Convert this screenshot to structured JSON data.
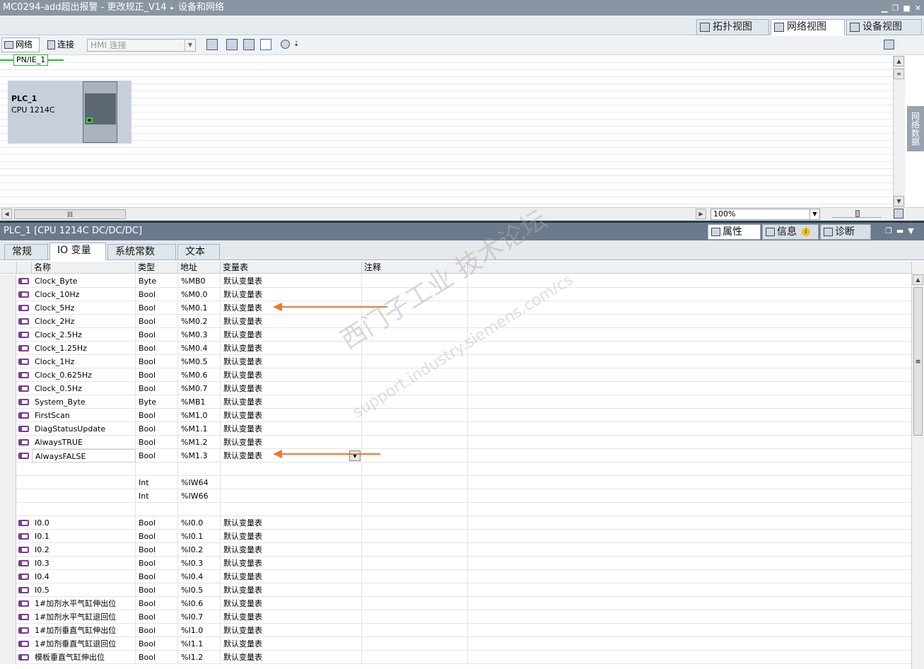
{
  "titlebar": {
    "project": "MC0294-add超出报警 - 更改规正_V14",
    "separator": "▸",
    "location": "设备和网络"
  },
  "view_tabs": [
    {
      "label": "拓扑视图",
      "icon": "topology-icon"
    },
    {
      "label": "网络视图",
      "icon": "network-icon",
      "active": true
    },
    {
      "label": "设备视图",
      "icon": "device-icon"
    }
  ],
  "toolbar": {
    "network_label": "网络",
    "connect_label": "连接",
    "hmi_connection_placeholder": "HMI 连接"
  },
  "canvas": {
    "subnet_label": "PN/IE_1",
    "plc_name": "PLC_1",
    "plc_type": "CPU 1214C",
    "side_panel_label": "网络数据",
    "zoom_value": "100%"
  },
  "inspector": {
    "title": "PLC_1 [CPU 1214C DC/DC/DC]",
    "tabs": [
      "属性",
      "信息",
      "诊断"
    ],
    "property_tabs": [
      "常规",
      "IO 变量",
      "系统常数",
      "文本"
    ],
    "active_property_tab": 1
  },
  "io_table": {
    "headers": [
      "名称",
      "类型",
      "地址",
      "变量表",
      "注释"
    ],
    "rows": [
      {
        "name": "Clock_Byte",
        "type": "Byte",
        "address": "%MB0",
        "table": "默认变量表",
        "icon": true
      },
      {
        "name": "Clock_10Hz",
        "type": "Bool",
        "address": "%M0.0",
        "table": "默认变量表",
        "icon": true
      },
      {
        "name": "Clock_5Hz",
        "type": "Bool",
        "address": "%M0.1",
        "table": "默认变量表",
        "icon": true
      },
      {
        "name": "Clock_2Hz",
        "type": "Bool",
        "address": "%M0.2",
        "table": "默认变量表",
        "icon": true
      },
      {
        "name": "Clock_2.5Hz",
        "type": "Bool",
        "address": "%M0.3",
        "table": "默认变量表",
        "icon": true
      },
      {
        "name": "Clock_1.25Hz",
        "type": "Bool",
        "address": "%M0.4",
        "table": "默认变量表",
        "icon": true
      },
      {
        "name": "Clock_1Hz",
        "type": "Bool",
        "address": "%M0.5",
        "table": "默认变量表",
        "icon": true
      },
      {
        "name": "Clock_0.625Hz",
        "type": "Bool",
        "address": "%M0.6",
        "table": "默认变量表",
        "icon": true
      },
      {
        "name": "Clock_0.5Hz",
        "type": "Bool",
        "address": "%M0.7",
        "table": "默认变量表",
        "icon": true
      },
      {
        "name": "System_Byte",
        "type": "Byte",
        "address": "%MB1",
        "table": "默认变量表",
        "icon": true
      },
      {
        "name": "FirstScan",
        "type": "Bool",
        "address": "%M1.0",
        "table": "默认变量表",
        "icon": true
      },
      {
        "name": "DiagStatusUpdate",
        "type": "Bool",
        "address": "%M1.1",
        "table": "默认变量表",
        "icon": true
      },
      {
        "name": "AlwaysTRUE",
        "type": "Bool",
        "address": "%M1.2",
        "table": "默认变量表",
        "icon": true
      },
      {
        "name": "AlwaysFALSE",
        "type": "Bool",
        "address": "%M1.3",
        "table": "默认变量表",
        "icon": true,
        "selected": true
      },
      {
        "name": "",
        "type": "",
        "address": "",
        "table": "",
        "icon": false
      },
      {
        "name": "",
        "type": "Int",
        "address": "%IW64",
        "table": "",
        "icon": false
      },
      {
        "name": "",
        "type": "Int",
        "address": "%IW66",
        "table": "",
        "icon": false
      },
      {
        "name": "",
        "type": "",
        "address": "",
        "table": "",
        "icon": false
      },
      {
        "name": "I0.0",
        "type": "Bool",
        "address": "%I0.0",
        "table": "默认变量表",
        "icon": true
      },
      {
        "name": "I0.1",
        "type": "Bool",
        "address": "%I0.1",
        "table": "默认变量表",
        "icon": true
      },
      {
        "name": "I0.2",
        "type": "Bool",
        "address": "%I0.2",
        "table": "默认变量表",
        "icon": true
      },
      {
        "name": "I0.3",
        "type": "Bool",
        "address": "%I0.3",
        "table": "默认变量表",
        "icon": true
      },
      {
        "name": "I0.4",
        "type": "Bool",
        "address": "%I0.4",
        "table": "默认变量表",
        "icon": true
      },
      {
        "name": "I0.5",
        "type": "Bool",
        "address": "%I0.5",
        "table": "默认变量表",
        "icon": true
      },
      {
        "name": "1#加剂水平气缸伸出位",
        "type": "Bool",
        "address": "%I0.6",
        "table": "默认变量表",
        "icon": true
      },
      {
        "name": "1#加剂水平气缸退回位",
        "type": "Bool",
        "address": "%I0.7",
        "table": "默认变量表",
        "icon": true
      },
      {
        "name": "1#加剂垂直气缸伸出位",
        "type": "Bool",
        "address": "%I1.0",
        "table": "默认变量表",
        "icon": true
      },
      {
        "name": "1#加剂垂直气缸退回位",
        "type": "Bool",
        "address": "%I1.1",
        "table": "默认变量表",
        "icon": true
      },
      {
        "name": "模板垂直气缸伸出位",
        "type": "Bool",
        "address": "%I1.2",
        "table": "默认变量表",
        "icon": true
      }
    ]
  },
  "watermark": {
    "line1": "西门子工业  技术论坛",
    "line2": "support.industry.siemens.com/cs"
  }
}
